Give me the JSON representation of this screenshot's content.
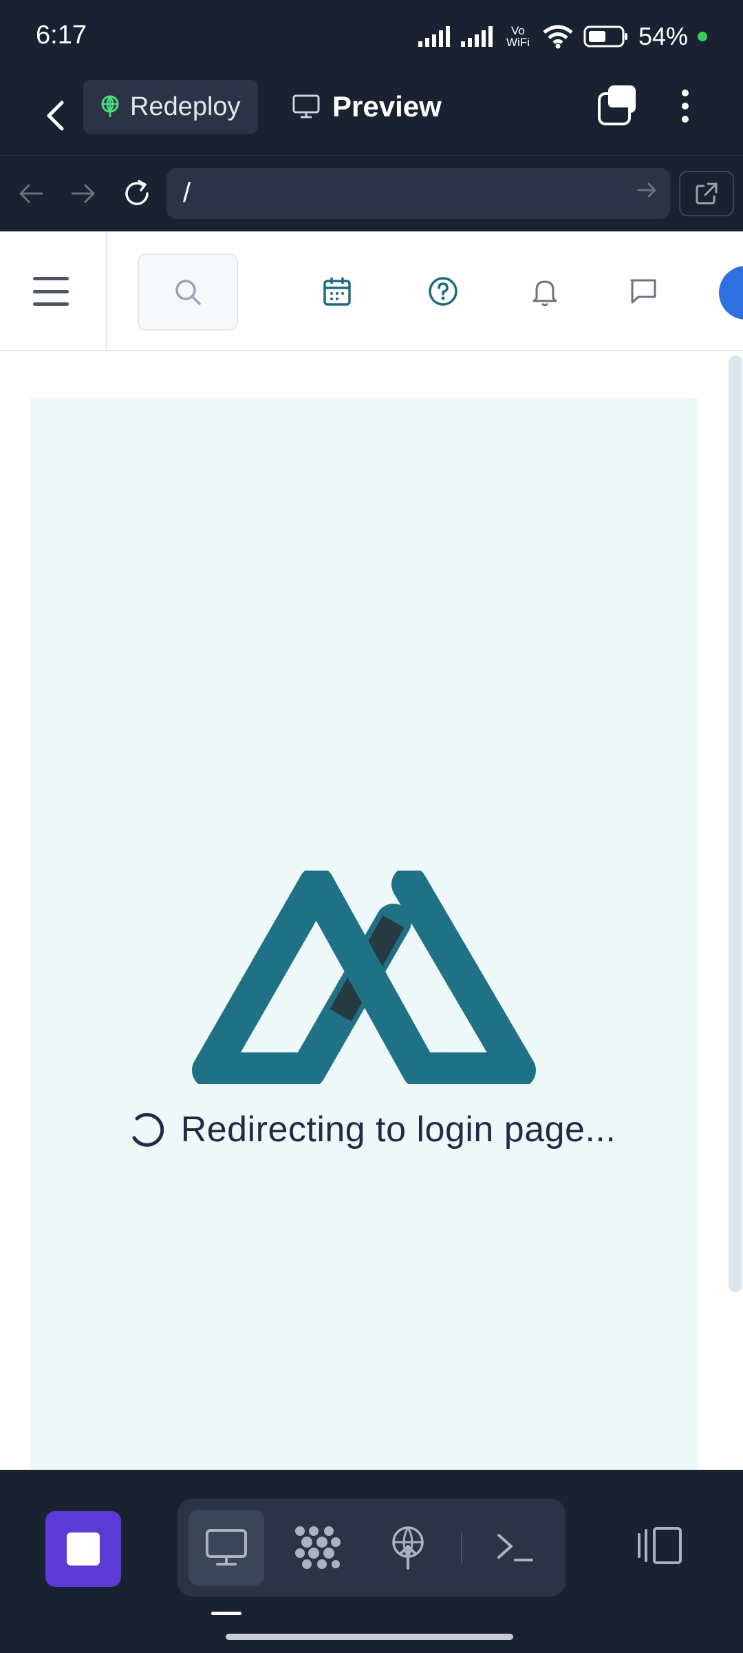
{
  "status_bar": {
    "time": "6:17",
    "network_label": "Vo WiFi",
    "battery_percent": "54%"
  },
  "app_bar": {
    "redeploy_label": "Redeploy",
    "preview_label": "Preview"
  },
  "browser": {
    "url": "/"
  },
  "page": {
    "loading_text": "Redirecting to login page..."
  },
  "colors": {
    "brand_teal": "#1f7285",
    "dark_teal": "#263a42",
    "accent_purple": "#5b3bd6",
    "avatar_blue": "#2f6fe0"
  },
  "icons": {
    "app_bar": [
      "back-arrow-icon",
      "globe-deploy-icon",
      "monitor-icon",
      "tabs-icon",
      "more-vertical-icon"
    ],
    "browser": [
      "nav-back-icon",
      "nav-forward-icon",
      "reload-icon",
      "go-arrow-icon",
      "open-external-icon"
    ],
    "site_header": [
      "menu-icon",
      "search-icon",
      "calendar-icon",
      "help-icon",
      "bell-icon",
      "chat-icon"
    ],
    "bottom_bar": [
      "stop-icon",
      "monitor-icon",
      "nodes-icon",
      "deploy-icon",
      "terminal-icon",
      "device-toggle-icon"
    ]
  }
}
